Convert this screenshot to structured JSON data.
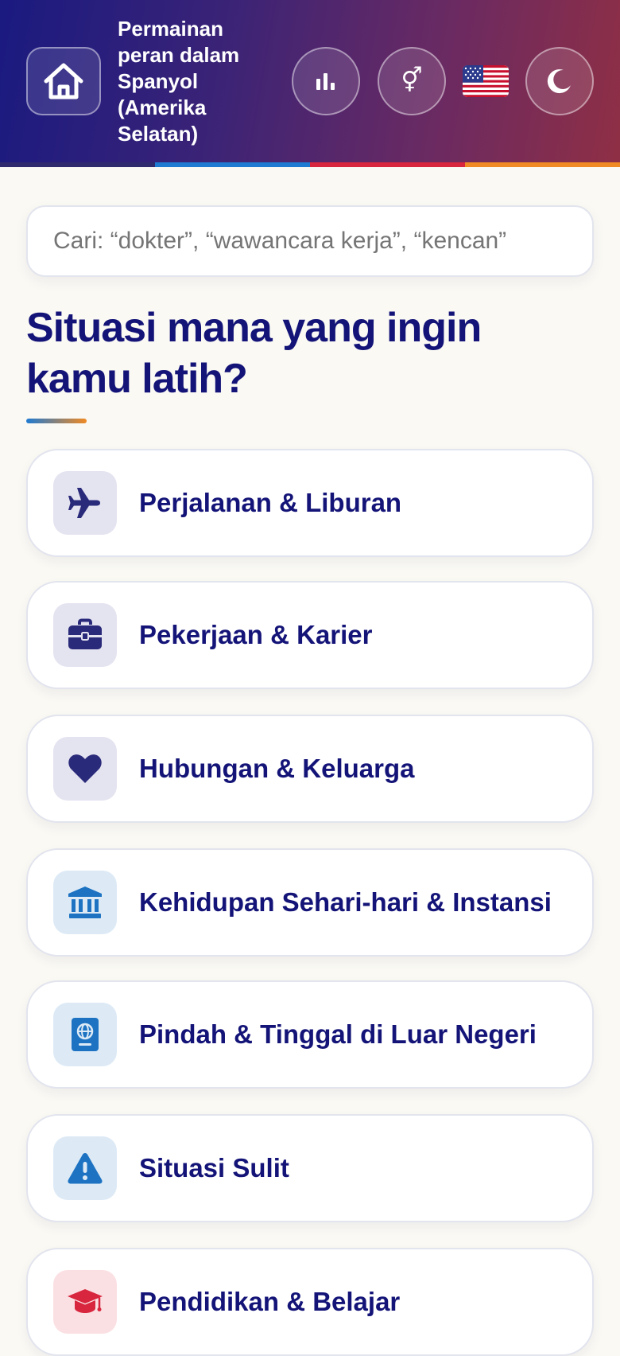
{
  "header": {
    "title": "Permainan peran dalam Spanyol (Amerika Selatan)",
    "home_icon": "home-icon",
    "stats_icon": "bar-chart-icon",
    "gender_symbol": "⚥",
    "flag_icon": "us-flag-icon",
    "theme_icon": "moon-icon"
  },
  "search": {
    "placeholder": "Cari: “dokter”, “wawancara kerja”, “kencan”",
    "value": ""
  },
  "main": {
    "heading": "Situasi mana yang ingin kamu latih?"
  },
  "categories": [
    {
      "label": "Perjalanan & Liburan",
      "icon": "airplane-icon",
      "tint": "purple"
    },
    {
      "label": "Pekerjaan & Karier",
      "icon": "briefcase-icon",
      "tint": "purple"
    },
    {
      "label": "Hubungan & Keluarga",
      "icon": "heart-icon",
      "tint": "purple"
    },
    {
      "label": "Kehidupan Sehari-hari & Instansi",
      "icon": "bank-building-icon",
      "tint": "blue"
    },
    {
      "label": "Pindah & Tinggal di Luar Negeri",
      "icon": "passport-icon",
      "tint": "blue"
    },
    {
      "label": "Situasi Sulit",
      "icon": "warning-icon",
      "tint": "blue"
    },
    {
      "label": "Pendidikan & Belajar",
      "icon": "graduation-cap-icon",
      "tint": "red"
    }
  ],
  "colors": {
    "navy_text": "#141478",
    "icon_purple": "#2a2a7a",
    "icon_blue": "#1d73c2",
    "icon_red": "#d7263d",
    "stripe_blue": "#1f7ad1",
    "stripe_red": "#d7263d",
    "stripe_orange": "#f08a24"
  }
}
